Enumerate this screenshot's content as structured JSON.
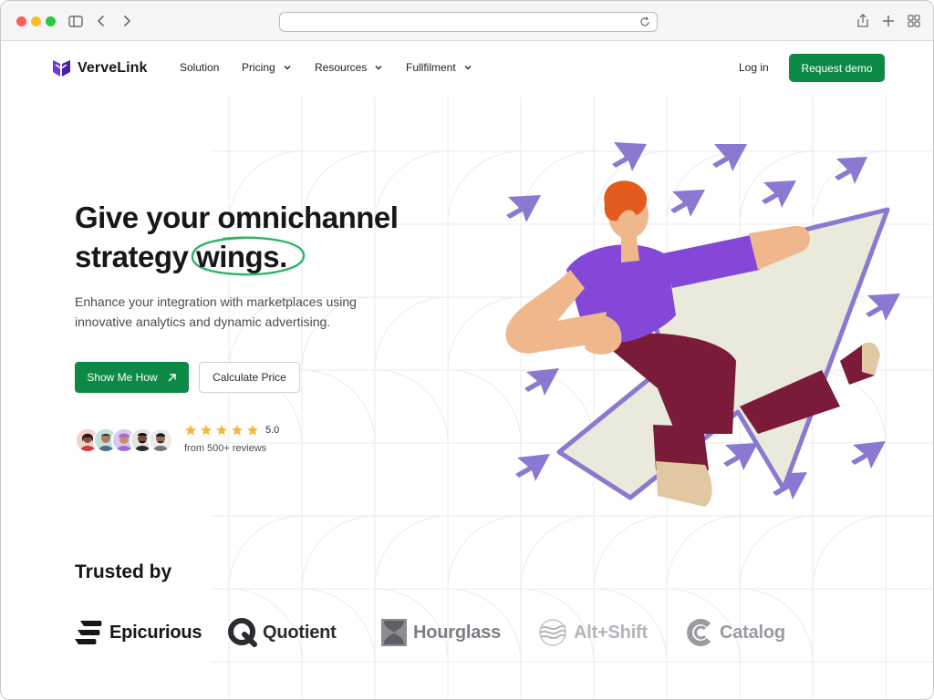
{
  "colors": {
    "brand_green": "#0c8a45",
    "brand_purple": "#6d3ad6",
    "arrow_purple": "#8b78d0",
    "star_yellow": "#f6b73c"
  },
  "browser": {
    "url": "",
    "icons": [
      "sidebar-icon",
      "back-icon",
      "forward-icon",
      "reload-icon",
      "share-icon",
      "new-tab-icon",
      "tab-overview-icon"
    ]
  },
  "nav": {
    "brand": "VerveLink",
    "items": [
      {
        "label": "Solution",
        "dropdown": false
      },
      {
        "label": "Pricing",
        "dropdown": true
      },
      {
        "label": "Resources",
        "dropdown": true
      },
      {
        "label": "Fullfilment",
        "dropdown": true
      }
    ],
    "login": "Log in",
    "cta": "Request demo"
  },
  "hero": {
    "headline_line1": "Give your omnichannel",
    "headline_line2_prefix": "strategy",
    "headline_highlight": "wings.",
    "subtext": "Enhance your integration with marketplaces using innovative analytics and dynamic advertising.",
    "primary_button": "Show Me How",
    "secondary_button": "Calculate Price",
    "rating_value": "5.0",
    "stars": 5,
    "reviews_text": "from 500+ reviews",
    "avatar_count": 5
  },
  "trusted": {
    "heading": "Trusted by",
    "brands": [
      {
        "name": "Epicurious",
        "icon": "epicurious-logo-icon",
        "color": "#16171b"
      },
      {
        "name": "Quotient",
        "icon": "quotient-logo-icon",
        "color": "#2b2c31"
      },
      {
        "name": "Hourglass",
        "icon": "hourglass-logo-icon",
        "color": "#7d7e84"
      },
      {
        "name": "Alt+Shift",
        "icon": "altshift-logo-icon",
        "color": "#b4b5ba"
      },
      {
        "name": "Catalog",
        "icon": "catalog-logo-icon",
        "color": "#9a9ba1"
      }
    ]
  }
}
